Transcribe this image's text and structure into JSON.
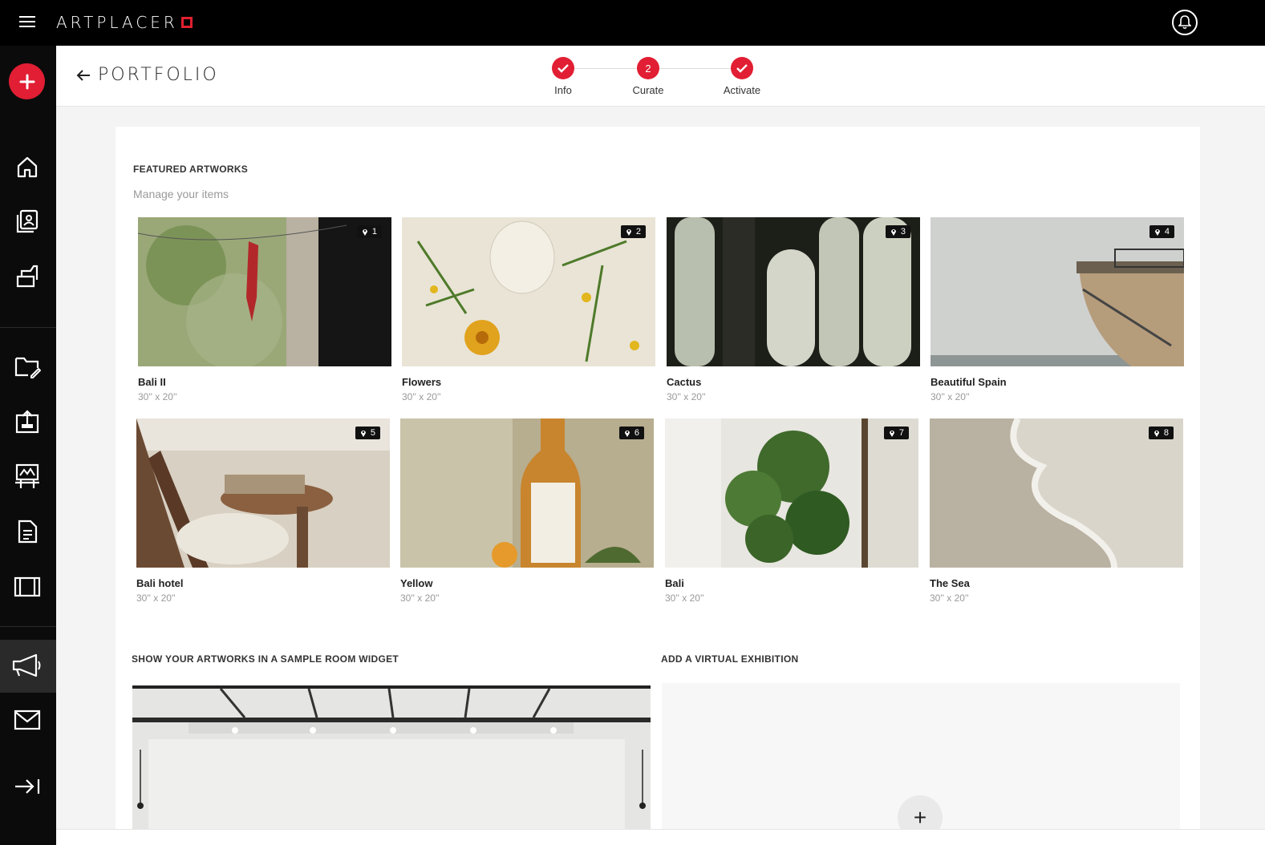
{
  "app": {
    "logo_text": "ARTPLACER",
    "brand_color": "#e11e33"
  },
  "header": {
    "back_label": "PORTFOLIO"
  },
  "stepper": {
    "steps": [
      {
        "label": "Info",
        "state": "done",
        "badge": ""
      },
      {
        "label": "Curate",
        "state": "active",
        "badge": "2"
      },
      {
        "label": "Activate",
        "state": "done",
        "badge": ""
      }
    ]
  },
  "featured": {
    "title": "FEATURED ARTWORKS",
    "subtitle": "Manage your items",
    "items": [
      {
        "title": "Bali II",
        "size": "30'' x 20''",
        "pin": "1"
      },
      {
        "title": "Flowers",
        "size": "30'' x 20''",
        "pin": "2"
      },
      {
        "title": "Cactus",
        "size": "30'' x 20''",
        "pin": "3"
      },
      {
        "title": "Beautiful Spain",
        "size": "30'' x 20''",
        "pin": "4"
      },
      {
        "title": "Bali hotel",
        "size": "30'' x 20''",
        "pin": "5"
      },
      {
        "title": "Yellow",
        "size": "30'' x 20''",
        "pin": "6"
      },
      {
        "title": "Bali",
        "size": "30'' x 20''",
        "pin": "7"
      },
      {
        "title": "The Sea",
        "size": "30'' x 20''",
        "pin": "8"
      }
    ]
  },
  "widget": {
    "title": "SHOW YOUR ARTWORKS IN A SAMPLE ROOM WIDGET"
  },
  "virtual": {
    "title": "ADD A VIRTUAL EXHIBITION",
    "add_symbol": "+"
  },
  "sidebar": {
    "icons": [
      "home-icon",
      "portfolio-icon",
      "rooms-icon",
      "folder-edit-icon",
      "upload-icon",
      "exhibition-icon",
      "document-icon",
      "frame-icon",
      "megaphone-icon",
      "mail-icon",
      "collapse-icon"
    ]
  }
}
